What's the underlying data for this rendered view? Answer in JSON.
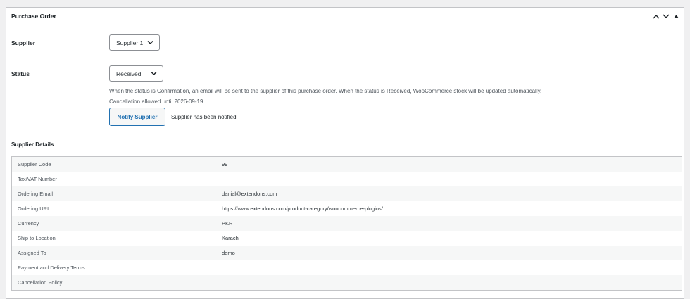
{
  "panel": {
    "title": "Purchase Order"
  },
  "supplier": {
    "label": "Supplier",
    "selected": "Supplier 1"
  },
  "status": {
    "label": "Status",
    "selected": "Received",
    "description": "When the status is Confirmation, an email will be sent to the supplier of this purchase order. When the status is Received, WooCommerce stock will be updated automatically.",
    "cancellation_note": "Cancellation allowed until 2026-09-19."
  },
  "notify": {
    "button_label": "Notify Supplier",
    "message": "Supplier has been notified."
  },
  "supplier_details": {
    "heading": "Supplier Details",
    "rows": [
      {
        "label": "Supplier Code",
        "value": "99"
      },
      {
        "label": "Tax/VAT Number",
        "value": ""
      },
      {
        "label": "Ordering Email",
        "value": "danial@extendons.com"
      },
      {
        "label": "Ordering URL",
        "value": "https://www.extendons.com/product-category/woocommerce-plugins/"
      },
      {
        "label": "Currency",
        "value": "PKR"
      },
      {
        "label": "Ship to Location",
        "value": "Karachi"
      },
      {
        "label": "Assigned To",
        "value": "demo"
      },
      {
        "label": "Payment and Delivery Terms",
        "value": ""
      },
      {
        "label": "Cancellation Policy",
        "value": ""
      }
    ]
  },
  "icons": {
    "move_up": "chevron-up-icon",
    "move_down": "chevron-down-icon",
    "toggle": "triangle-up-icon"
  }
}
